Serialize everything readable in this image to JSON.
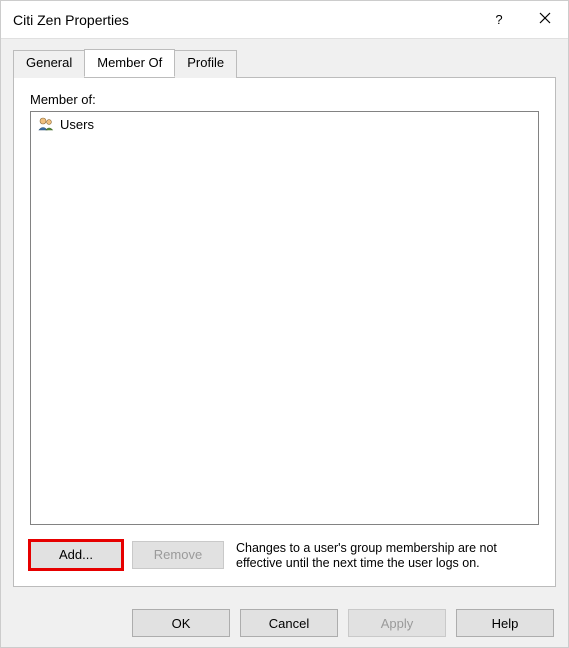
{
  "window": {
    "title": "Citi Zen Properties"
  },
  "tabs": {
    "general": "General",
    "member_of": "Member Of",
    "profile": "Profile"
  },
  "panel": {
    "label": "Member of:",
    "items": [
      {
        "name": "Users"
      }
    ],
    "add_label": "Add...",
    "remove_label": "Remove",
    "hint": "Changes to a user's group membership are not effective until the next time the user logs on."
  },
  "buttons": {
    "ok": "OK",
    "cancel": "Cancel",
    "apply": "Apply",
    "help": "Help"
  }
}
